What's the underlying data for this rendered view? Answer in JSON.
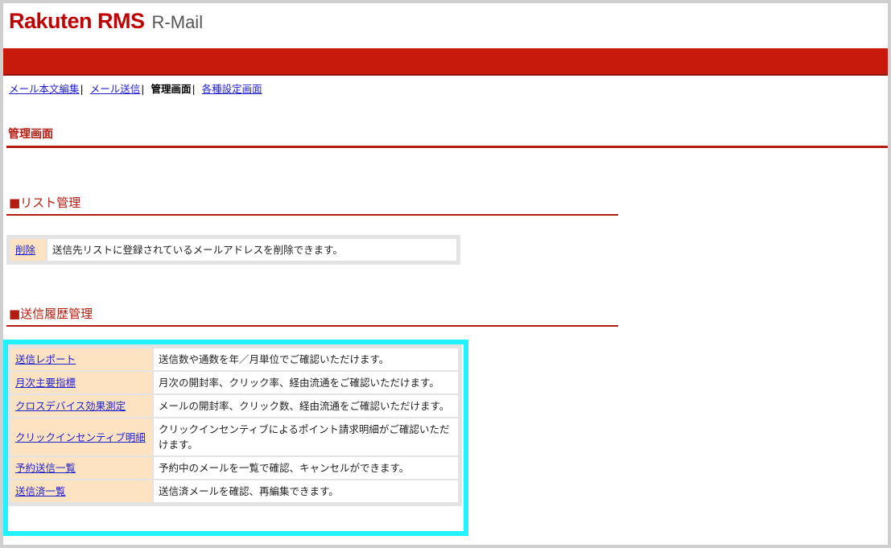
{
  "logo": {
    "main": "Rakuten RMS",
    "sub": "R-Mail"
  },
  "nav": {
    "items": [
      {
        "label": "メール本文編集"
      },
      {
        "label": "メール送信"
      },
      {
        "label": "管理画面"
      },
      {
        "label": "各種設定画面"
      }
    ],
    "separator": "|"
  },
  "page_title": "管理画面",
  "sections": {
    "list": {
      "title": "■リスト管理",
      "rows": [
        {
          "key": "削除",
          "desc": "送信先リストに登録されているメールアドレスを削除できます。"
        }
      ]
    },
    "history": {
      "title": "■送信履歴管理",
      "rows": [
        {
          "key": "送信レポート",
          "desc": "送信数や通数を年／月単位でご確認いただけます。"
        },
        {
          "key": "月次主要指標",
          "desc": "月次の開封率、クリック率、経由流通をご確認いただけます。"
        },
        {
          "key": "クロスデバイス効果測定",
          "desc": "メールの開封率、クリック数、経由流通をご確認いただけます。"
        },
        {
          "key": "クリックインセンティブ明細",
          "desc": "クリックインセンティブによるポイント請求明細がご確認いただけます。"
        },
        {
          "key": "予約送信一覧",
          "desc": "予約中のメールを一覧で確認、キャンセルができます。"
        },
        {
          "key": "送信済一覧",
          "desc": "送信済メールを確認、再編集できます。"
        }
      ]
    }
  },
  "colors": {
    "brand_red": "#c81a0c",
    "heading_red": "#b31c10",
    "key_cell": "#fde3c2",
    "link": "#2222cc",
    "highlight": "#22f2ff"
  }
}
